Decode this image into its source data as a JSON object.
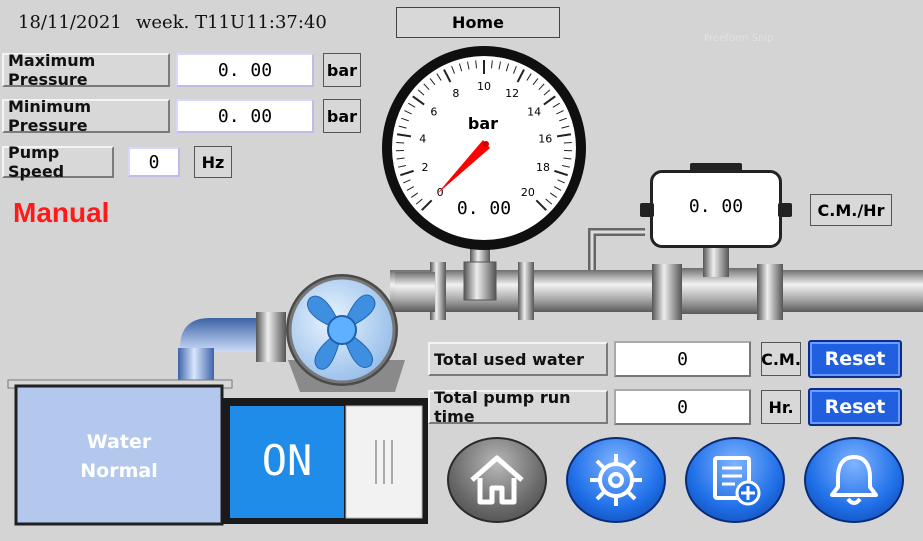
{
  "header": {
    "date": "18/11/2021",
    "week": "week. T11U",
    "time": "11:37:40",
    "home_label": "Home",
    "watermark": "Freeform Snip"
  },
  "pressure": {
    "max_label": "Maximum Pressure",
    "max_value": "0. 00",
    "max_unit": "bar",
    "min_label": "Minimum Pressure",
    "min_value": "0. 00",
    "min_unit": "bar"
  },
  "pump": {
    "speed_label": "Pump Speed",
    "speed_value": "0",
    "speed_unit": "Hz",
    "mode": "Manual",
    "switch_label": "ON"
  },
  "gauge": {
    "unit": "bar",
    "value": "0. 00",
    "ticks": [
      "0",
      "2",
      "4",
      "6",
      "8",
      "10",
      "12",
      "14",
      "16",
      "18",
      "20"
    ]
  },
  "flow": {
    "value": "0. 00",
    "unit": "C.M./Hr"
  },
  "tank": {
    "line1": "Water",
    "line2": "Normal"
  },
  "totals": {
    "water_label": "Total used water",
    "water_value": "0",
    "water_unit": "C.M.",
    "water_reset": "Reset",
    "runtime_label": "Total pump run time",
    "runtime_value": "0",
    "runtime_unit": "Hr.",
    "runtime_reset": "Reset"
  },
  "nav": {
    "home_icon": "home-icon",
    "settings_icon": "gear-icon",
    "log_icon": "document-add-icon",
    "alarm_icon": "bell-icon"
  },
  "colors": {
    "manual": "#ff1a1a",
    "nav_blue": "#1f6fe8",
    "nav_grey": "#7a7a7a",
    "switch_blue": "#1e8ce8"
  }
}
